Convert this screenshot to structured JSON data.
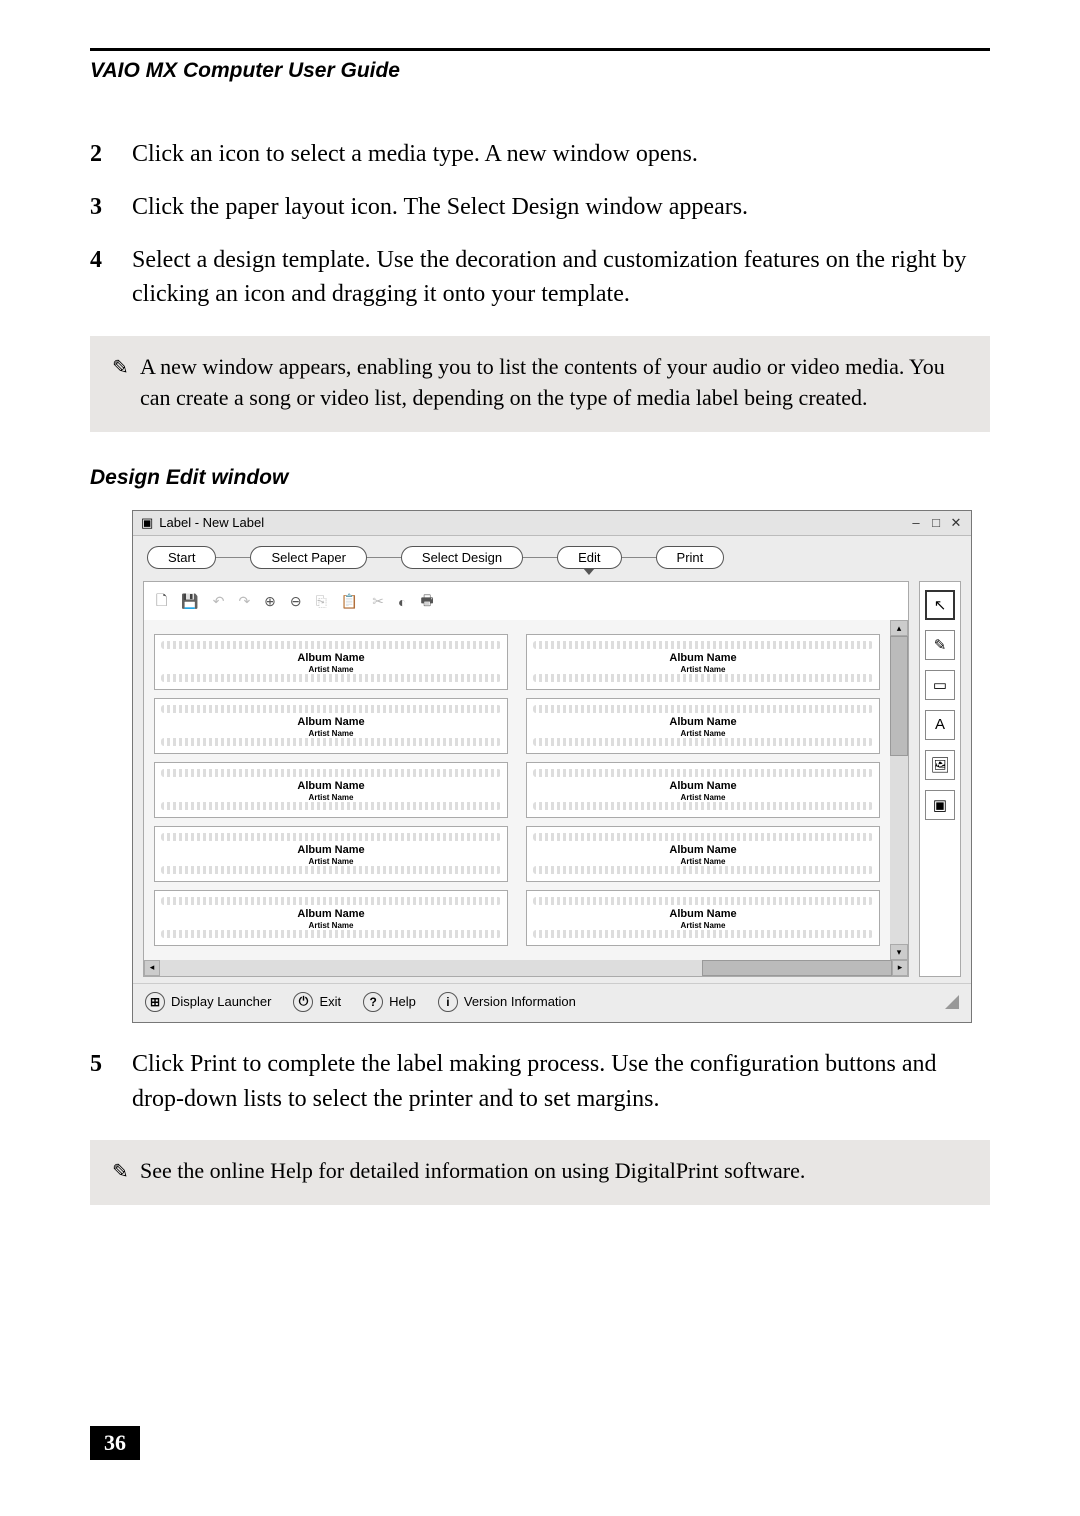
{
  "header": {
    "title": "VAIO MX Computer User Guide"
  },
  "steps_before": [
    {
      "num": "2",
      "text": "Click an icon to select a media type. A new window opens."
    },
    {
      "num": "3",
      "text": "Click the paper layout icon. The Select Design window appears."
    },
    {
      "num": "4",
      "text": "Select a design template. Use the decoration and customization features on the right by clicking an icon and dragging it onto your template."
    }
  ],
  "note1": "A new window appears, enabling you to list the contents of your audio or video media. You can create a song or video list, depending on the type of media label being created.",
  "caption": "Design Edit window",
  "screenshot": {
    "title": "Label - New Label",
    "pills": [
      "Start",
      "Select Paper",
      "Select Design",
      "Edit",
      "Print"
    ],
    "selected_pill_index": 3,
    "card": {
      "line1": "Album Name",
      "line2": "Artist Name"
    },
    "card_count": 10,
    "footer": {
      "launcher": "Display Launcher",
      "exit": "Exit",
      "help": "Help",
      "version": "Version Information"
    }
  },
  "steps_after": [
    {
      "num": "5",
      "text": "Click Print to complete the label making process. Use the configuration buttons and drop-down lists to select the printer and to set margins."
    }
  ],
  "note2": "See the online Help for detailed information on using DigitalPrint software.",
  "page_number": "36"
}
